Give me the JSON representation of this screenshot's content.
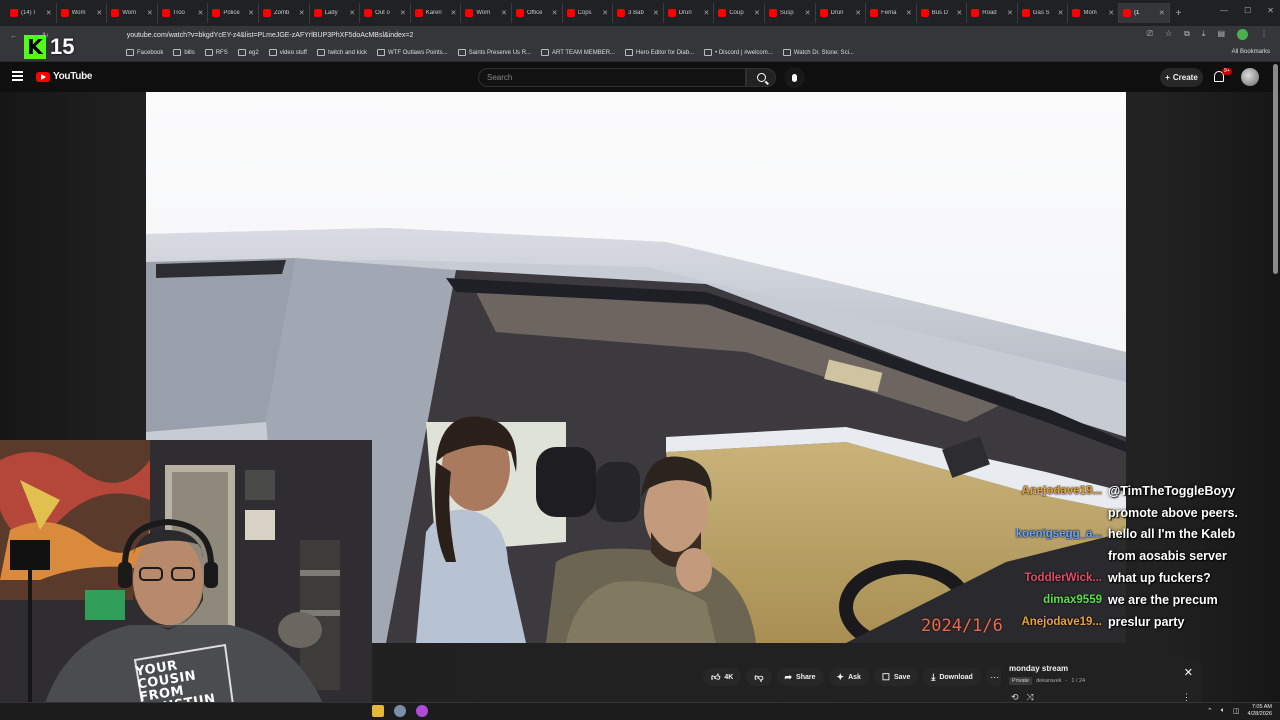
{
  "browser": {
    "tabs": [
      {
        "title": "(14) I"
      },
      {
        "title": "Wom"
      },
      {
        "title": "Wom"
      },
      {
        "title": "Troo"
      },
      {
        "title": "Police"
      },
      {
        "title": "Zomb"
      },
      {
        "title": "Lady"
      },
      {
        "title": "Out o"
      },
      {
        "title": "Karen"
      },
      {
        "title": "Wom"
      },
      {
        "title": "Office"
      },
      {
        "title": "Cops"
      },
      {
        "title": "3 Bab"
      },
      {
        "title": "Drun"
      },
      {
        "title": "Coup"
      },
      {
        "title": "Susp"
      },
      {
        "title": "Drun"
      },
      {
        "title": "Fema"
      },
      {
        "title": "Bus D"
      },
      {
        "title": "Road"
      },
      {
        "title": "Gas S"
      },
      {
        "title": "Mom"
      },
      {
        "title": "(1"
      }
    ],
    "new_tab_label": "+",
    "url": "youtube.com/watch?v=bkgdYcEY-z4&list=PLmeJGE-zAFYrlBUP3PhXF5doAcMBsl&index=2",
    "bookmarks": [
      {
        "label": "Facebook"
      },
      {
        "label": "bills"
      },
      {
        "label": "RFS"
      },
      {
        "label": "eg2"
      },
      {
        "label": "video stuff"
      },
      {
        "label": "twitch and kick"
      },
      {
        "label": "WTF Outlaws Points..."
      },
      {
        "label": "Saints Preserve Us R..."
      },
      {
        "label": "ART TEAM MEMBER..."
      },
      {
        "label": "Hero Editor for Diab..."
      },
      {
        "label": "• Discord | #welcom..."
      },
      {
        "label": "Watch Dr. Stone: Sci..."
      }
    ],
    "all_bookmarks_label": "All Bookmarks",
    "accent_color": "#53fc18"
  },
  "kick_overlay": {
    "logo": "K",
    "count": "15"
  },
  "youtube": {
    "logo_text": "YouTube",
    "search_placeholder": "Search",
    "create_label": "Create",
    "notifications_badge": "9+"
  },
  "video": {
    "timestamp": "2024/1/6"
  },
  "chat": [
    {
      "user": "Anejodave19...",
      "color": "#e8a33c",
      "message": "@TimTheToggleBoyy"
    },
    {
      "user": "",
      "color": "#ffffff",
      "message": "promote above peers."
    },
    {
      "user": "koenigsegg_a...",
      "color": "#6aa8ff",
      "message": "hello all I'm the Kaleb"
    },
    {
      "user": "",
      "color": "#ffffff",
      "message": "from aosabis server"
    },
    {
      "user": "ToddlerWick...",
      "color": "#e04e6a",
      "message": "what up fuckers?"
    },
    {
      "user": "dimax9559",
      "color": "#59e04a",
      "message": "we are the precum"
    },
    {
      "user": "Anejodave19...",
      "color": "#e8a33c",
      "message": "preslur party"
    }
  ],
  "webcam": {
    "shirt_lines": [
      "YOUR",
      "COUSIN",
      "FROM",
      "DAHSTUN"
    ]
  },
  "actions": {
    "like_count": "4K",
    "share_label": "Share",
    "ask_label": "Ask",
    "save_label": "Save",
    "download_label": "Download"
  },
  "playlist": {
    "title": "monday stream",
    "privacy": "Private",
    "owner": "dekaravek",
    "position": "1 / 24"
  },
  "taskbar": {
    "time": "7:05 AM",
    "date": "4/28/2026"
  }
}
